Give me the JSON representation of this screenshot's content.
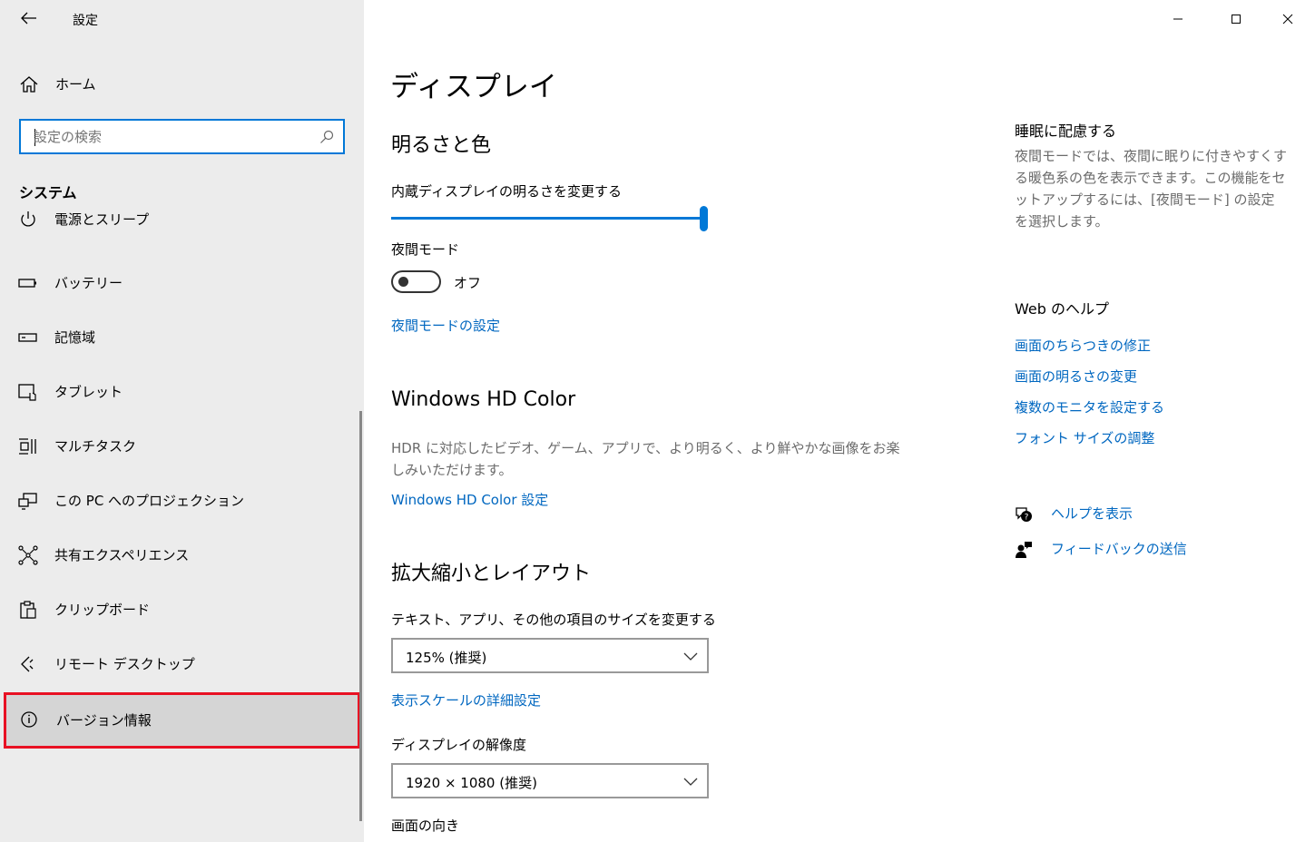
{
  "app": {
    "title": "設定"
  },
  "sidebar": {
    "home_label": "ホーム",
    "search_placeholder": "設定の検索",
    "section_title": "システム",
    "items": [
      {
        "label": "電源とスリープ",
        "icon": "power-icon"
      },
      {
        "label": "バッテリー",
        "icon": "battery-icon"
      },
      {
        "label": "記憶域",
        "icon": "storage-icon"
      },
      {
        "label": "タブレット",
        "icon": "tablet-icon"
      },
      {
        "label": "マルチタスク",
        "icon": "multitask-icon"
      },
      {
        "label": "この PC へのプロジェクション",
        "icon": "projection-icon"
      },
      {
        "label": "共有エクスペリエンス",
        "icon": "share-icon"
      },
      {
        "label": "クリップボード",
        "icon": "clipboard-icon"
      },
      {
        "label": "リモート デスクトップ",
        "icon": "remote-desktop-icon"
      },
      {
        "label": "バージョン情報",
        "icon": "info-icon",
        "selected": true
      }
    ]
  },
  "main": {
    "title": "ディスプレイ",
    "brightness": {
      "heading": "明るさと色",
      "slider_label": "内蔵ディスプレイの明るさを変更する",
      "slider_value_percent": 100,
      "night_mode_label": "夜間モード",
      "night_mode_state": "オフ",
      "night_mode_link": "夜間モードの設定"
    },
    "hdr": {
      "heading": "Windows HD Color",
      "description": "HDR に対応したビデオ、ゲーム、アプリで、より明るく、より鮮やかな画像をお楽しみいただけます。",
      "link": "Windows HD Color 設定"
    },
    "scale": {
      "heading": "拡大縮小とレイアウト",
      "size_label": "テキスト、アプリ、その他の項目のサイズを変更する",
      "size_value": "125% (推奨)",
      "advanced_link": "表示スケールの詳細設定",
      "resolution_label": "ディスプレイの解像度",
      "resolution_value": "1920 × 1080 (推奨)",
      "orientation_label": "画面の向き"
    }
  },
  "right": {
    "sleep_title": "睡眠に配慮する",
    "sleep_desc": "夜間モードでは、夜間に眠りに付きやすくする暖色系の色を表示できます。この機能をセットアップするには、[夜間モード] の設定を選択します。",
    "web_help_title": "Web のヘルプ",
    "web_links": [
      "画面のちらつきの修正",
      "画面の明るさの変更",
      "複数のモニタを設定する",
      "フォント サイズの調整"
    ],
    "help_link": "ヘルプを表示",
    "feedback_link": "フィードバックの送信"
  },
  "colors": {
    "accent": "#0078d7",
    "link": "#0067c0",
    "highlight": "#e81123"
  }
}
